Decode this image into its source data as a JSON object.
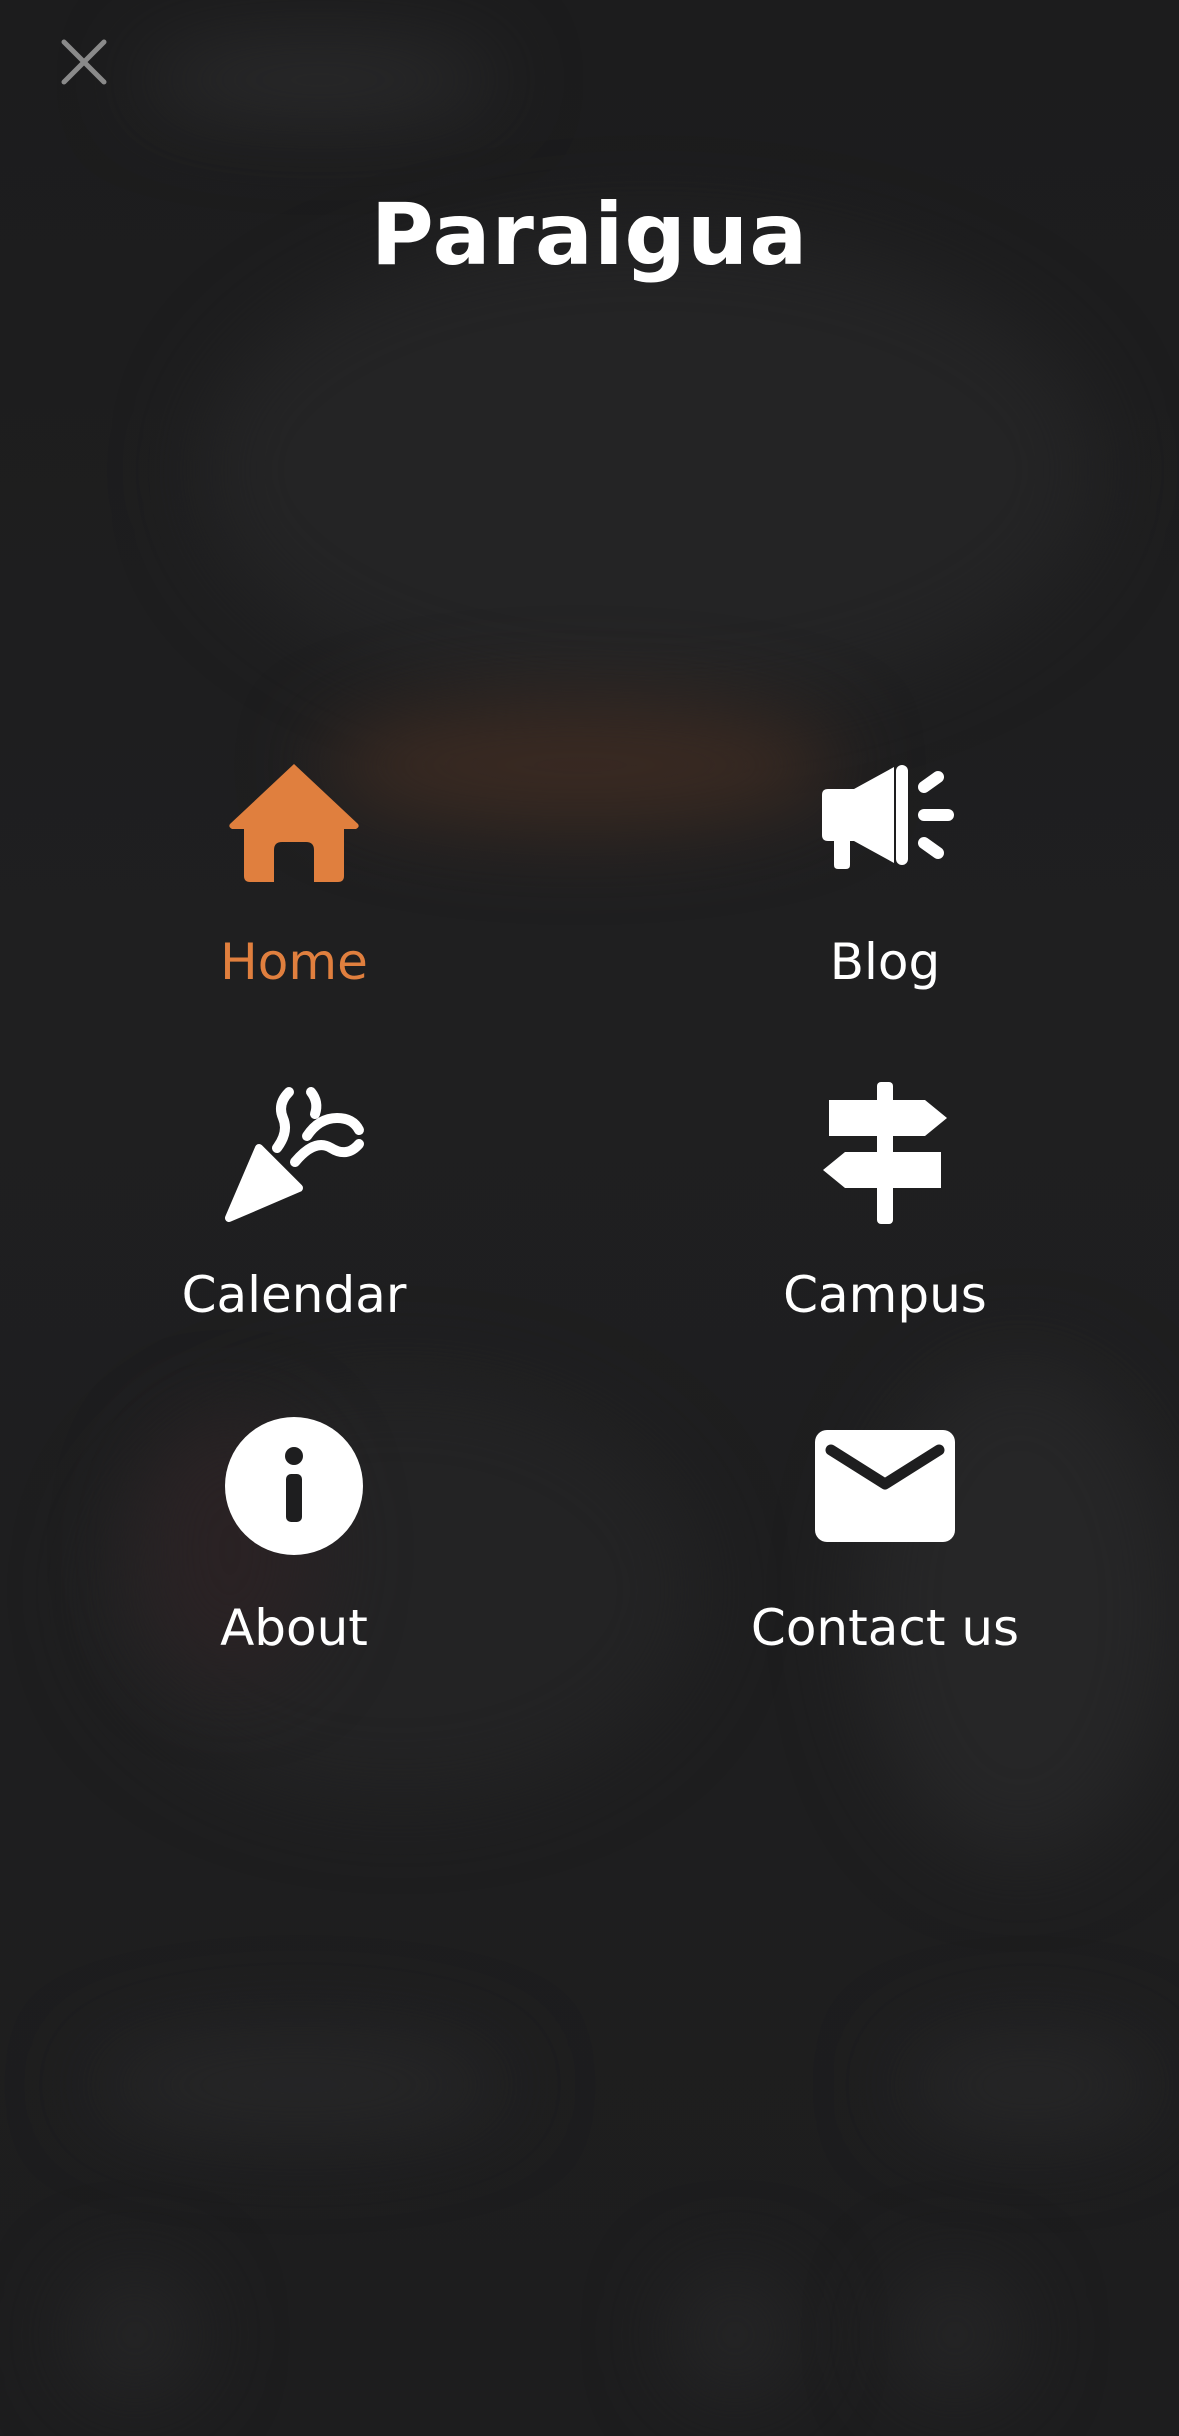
{
  "app": {
    "title": "Paraigua"
  },
  "colors": {
    "background": "#1e1e1f",
    "accent": "#e07f3e",
    "text": "#ffffff",
    "close_icon": "#8a8a8a"
  },
  "close_button": {
    "icon": "close-icon"
  },
  "menu": {
    "items": [
      {
        "label": "Home",
        "icon": "home-icon",
        "active": true
      },
      {
        "label": "Blog",
        "icon": "megaphone-icon",
        "active": false
      },
      {
        "label": "Calendar",
        "icon": "party-popper-icon",
        "active": false
      },
      {
        "label": "Campus",
        "icon": "signpost-icon",
        "active": false
      },
      {
        "label": "About",
        "icon": "info-icon",
        "active": false
      },
      {
        "label": "Contact us",
        "icon": "envelope-icon",
        "active": false
      }
    ]
  }
}
